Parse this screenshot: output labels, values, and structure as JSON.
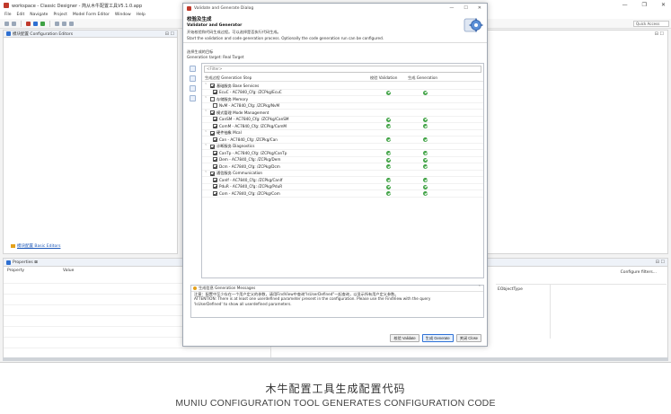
{
  "window": {
    "title": "workspace - Classic Designer - 简从木牛配置工具V5.1.0.app",
    "controls": [
      "—",
      "❐",
      "✕"
    ]
  },
  "menu": [
    "File",
    "Edit",
    "Navigate",
    "Project",
    "Model Form Editor",
    "Window",
    "Help"
  ],
  "quick_access": "Quick Access",
  "editor_panel": {
    "tab_label": "模块配置 Configuration Editors",
    "controls": "⊟ ☐",
    "basic_editor_link": "模块配置 Basic Editors"
  },
  "properties": {
    "tab_label": "Properties ⊠",
    "col_property": "Property",
    "col_value": "Value",
    "configure_filters": "Configure filters...",
    "eobject_type": "EObjectType",
    "controls": "⊟ ☐"
  },
  "right_area": {
    "controls": "⊟ ☐"
  },
  "dialog": {
    "title": "Validate and Generate Dialog",
    "controls": [
      "—",
      "☐",
      "✕"
    ],
    "heading_cn": "校验及生成",
    "heading_en": "Validator and Generator",
    "desc_cn": "开始校验和代码生成过程。可以选择是否执行代码生成。",
    "desc_en": "Start the validation and code generation process. Optionally the code generation run can be configured.",
    "target_cn": "选择生成的目标",
    "target_en": "Generation target: Real Target",
    "filter_placeholder": "<Filter>",
    "col_step": "生成过程 Generation Step",
    "col_validation": "校验 Validation",
    "col_generation": "生成 Generation",
    "rows": [
      {
        "label": "基础服务 Base Services",
        "level": 0,
        "checked": true,
        "group": true,
        "validation": false,
        "generation": false
      },
      {
        "label": "EcuC - AC7840_Cfg: /ZCPkg/EcuC",
        "level": 1,
        "checked": true,
        "group": false,
        "validation": true,
        "generation": true
      },
      {
        "label": "存储服务 Memory",
        "level": 0,
        "checked": false,
        "group": true,
        "validation": false,
        "generation": false
      },
      {
        "label": "NvM - AC7840_Cfg: /ZCPkg/NvM",
        "level": 1,
        "checked": false,
        "group": false,
        "validation": false,
        "generation": false
      },
      {
        "label": "模式管理 Mode Management",
        "level": 0,
        "checked": true,
        "group": true,
        "validation": false,
        "generation": false
      },
      {
        "label": "CanSM - AC7840_Cfg: /ZCPkg/CanSM",
        "level": 1,
        "checked": true,
        "group": false,
        "validation": true,
        "generation": true
      },
      {
        "label": "ComM - AC7840_Cfg: /ZCPkg/ComM",
        "level": 1,
        "checked": true,
        "group": false,
        "validation": true,
        "generation": true
      },
      {
        "label": "硬件抽象 Mcal",
        "level": 0,
        "checked": true,
        "group": true,
        "validation": false,
        "generation": false
      },
      {
        "label": "Can - AC7840_Cfg: /ZCPkg/Can",
        "level": 1,
        "checked": true,
        "group": false,
        "validation": true,
        "generation": true
      },
      {
        "label": "诊断服务 Diagnostics",
        "level": 0,
        "checked": true,
        "group": true,
        "validation": false,
        "generation": false
      },
      {
        "label": "CanTp - AC7840_Cfg: /ZCPkg/CanTp",
        "level": 1,
        "checked": true,
        "group": false,
        "validation": true,
        "generation": true
      },
      {
        "label": "Dem - AC7840_Cfg: /ZCPkg/Dem",
        "level": 1,
        "checked": true,
        "group": false,
        "validation": true,
        "generation": true
      },
      {
        "label": "Dcm - AC7840_Cfg: /ZCPkg/Dcm",
        "level": 1,
        "checked": true,
        "group": false,
        "validation": true,
        "generation": true
      },
      {
        "label": "通信服务 Communication",
        "level": 0,
        "checked": true,
        "group": true,
        "validation": false,
        "generation": false
      },
      {
        "label": "CanIf - AC7840_Cfg: /ZCPkg/CanIf",
        "level": 1,
        "checked": true,
        "group": false,
        "validation": true,
        "generation": true
      },
      {
        "label": "PduR - AC7840_Cfg: /ZCPkg/PduR",
        "level": 1,
        "checked": true,
        "group": false,
        "validation": true,
        "generation": true
      },
      {
        "label": "Com - AC7840_Cfg: /ZCPkg/Com",
        "level": 1,
        "checked": true,
        "group": false,
        "validation": true,
        "generation": true
      }
    ],
    "messages_tab": "生成信息 Generation Messages",
    "messages": [
      "注意：配置中至少存在一个用户定义的参数，请用FindView中查询\"IsUserDefined\"一起查询，以显示所有用户定义参数。",
      "ATTENTION: There is at least one userdefined parameter present in the configuration. Please use the FindView with the query",
      "'IsUserDefined' to show all userdefined parameters."
    ],
    "buttons": {
      "validate": "校验 Validate",
      "generate": "生成 Generate",
      "close": "关闭 Close"
    }
  },
  "caption": {
    "cn": "木牛配置工具生成配置代码",
    "en": "MUNIU CONFIGURATION TOOL GENERATES CONFIGURATION CODE"
  }
}
